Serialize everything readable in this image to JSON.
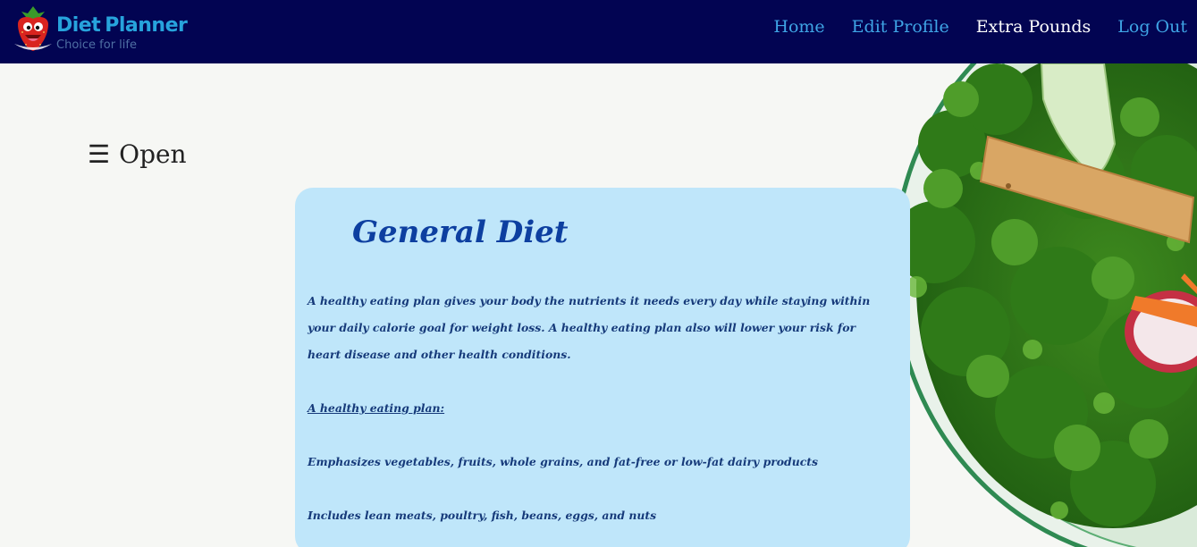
{
  "brand": {
    "name_first": "Diet",
    "name_second": "Planner",
    "tagline": "Choice for life",
    "logo_icon": "strawberry-icon"
  },
  "nav": {
    "items": [
      {
        "label": "Home",
        "active": false
      },
      {
        "label": "Edit Profile",
        "active": false
      },
      {
        "label": "Extra Pounds",
        "active": true
      },
      {
        "label": "Log Out",
        "active": false
      }
    ]
  },
  "menu": {
    "icon": "hamburger-icon",
    "icon_glyph": "☰",
    "label": "Open"
  },
  "content": {
    "title": "General Diet",
    "paragraphs": [
      "A healthy eating plan gives your body the nutrients it needs every day while staying within your daily calorie goal for weight loss. A healthy eating plan also will lower your risk for heart disease and other health conditions.",
      "A healthy eating plan:",
      "Emphasizes vegetables, fruits, whole grains, and fat-free or low-fat dairy products",
      "Includes lean meats, poultry, fish, beans, eggs, and nuts"
    ]
  },
  "colors": {
    "header_bg": "#020452",
    "nav_link": "#3fa5e6",
    "nav_active": "#ffffff",
    "card_bg": "#bfe6fa",
    "title": "#0d3fa0",
    "body_text": "#163a7a"
  }
}
